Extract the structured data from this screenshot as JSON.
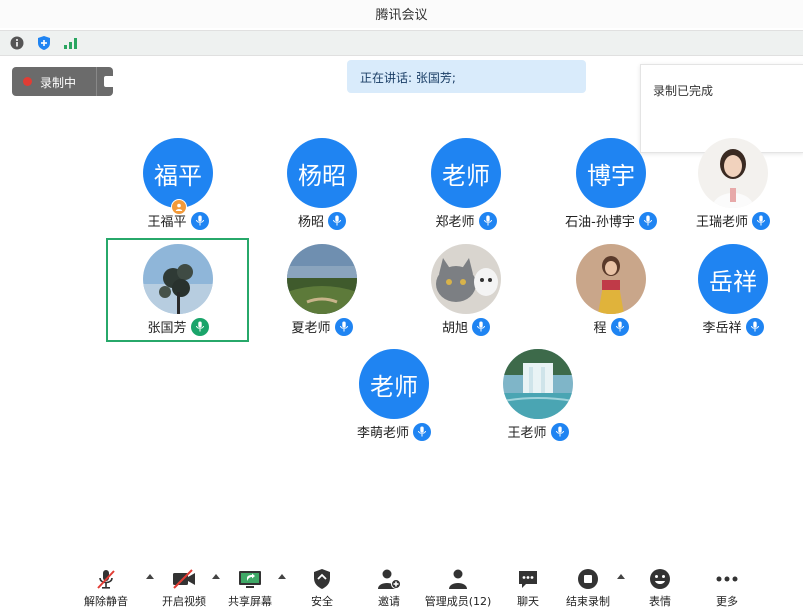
{
  "window": {
    "title": "腾讯会议"
  },
  "recording": {
    "label": "录制中"
  },
  "speaking": {
    "text": "正在讲话: 张国芳;"
  },
  "notice": {
    "text": "录制已完成"
  },
  "participants": [
    {
      "name": "王福平",
      "avatar_text": "福平",
      "host": true
    },
    {
      "name": "杨昭",
      "avatar_text": "杨昭"
    },
    {
      "name": "郑老师",
      "avatar_text": "老师"
    },
    {
      "name": "石油-孙博宇",
      "avatar_text": "博宇"
    },
    {
      "name": "王瑞老师",
      "avatar_text": ""
    },
    {
      "name": "张国芳",
      "avatar_text": "",
      "speaking": true
    },
    {
      "name": "夏老师",
      "avatar_text": ""
    },
    {
      "name": "胡旭",
      "avatar_text": ""
    },
    {
      "name": "程",
      "avatar_text": ""
    },
    {
      "name": "李岳祥",
      "avatar_text": "岳祥"
    },
    {
      "name": "李萌老师",
      "avatar_text": "老师"
    },
    {
      "name": "王老师",
      "avatar_text": ""
    }
  ],
  "toolbar": {
    "unmute": "解除静音",
    "video": "开启视频",
    "share": "共享屏幕",
    "security": "安全",
    "invite": "邀请",
    "members": "管理成员(12)",
    "chat": "聊天",
    "end_record": "结束录制",
    "reaction": "表情",
    "more": "更多"
  },
  "colors": {
    "accent": "#1f84f2",
    "speaking_border": "#27a86a",
    "rec_dot": "#e13c34"
  }
}
